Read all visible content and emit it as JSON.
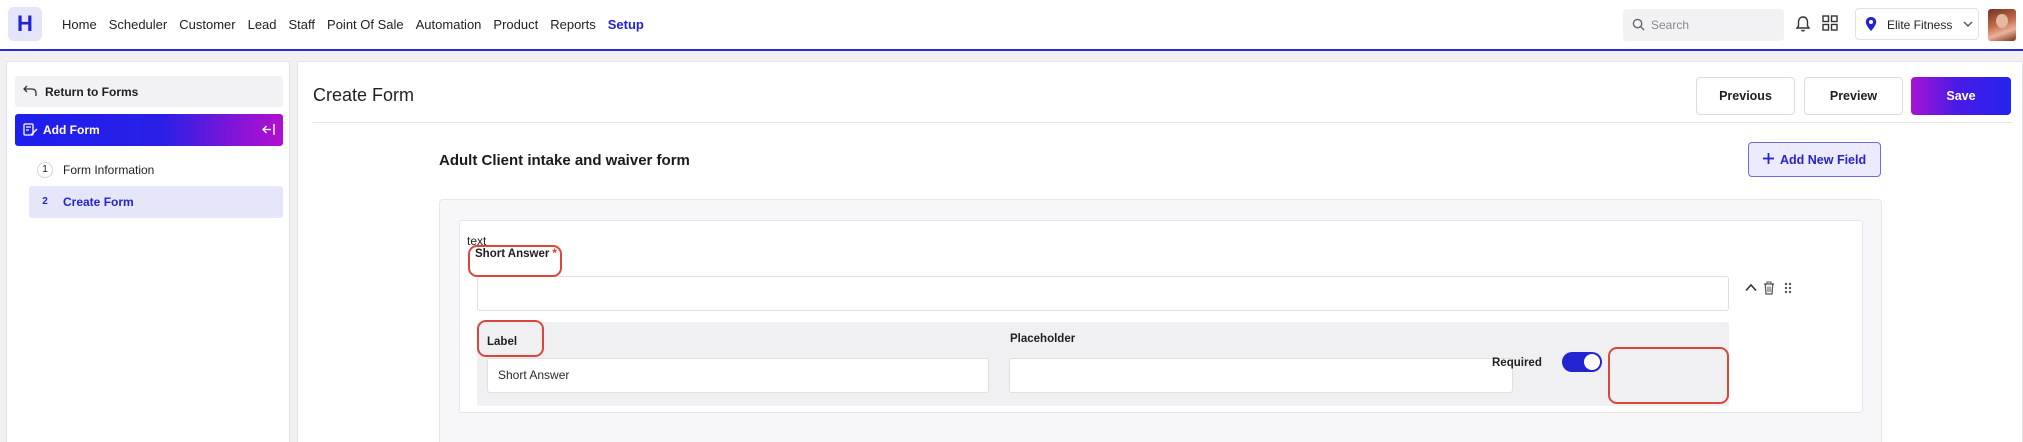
{
  "app": {
    "logo_letter": "H",
    "nav": [
      "Home",
      "Scheduler",
      "Customer",
      "Lead",
      "Staff",
      "Point Of Sale",
      "Automation",
      "Product",
      "Reports",
      "Setup"
    ],
    "active_nav": "Setup",
    "search_placeholder": "Search",
    "location": "Elite Fitness"
  },
  "sidebar": {
    "return_label": "Return to Forms",
    "section_label": "Add Form",
    "steps": [
      {
        "number": "1",
        "label": "Form Information"
      },
      {
        "number": "2",
        "label": "Create Form"
      }
    ],
    "active_step": 2
  },
  "main": {
    "title": "Create Form",
    "buttons": {
      "previous": "Previous",
      "preview": "Preview",
      "save": "Save"
    },
    "form_title": "Adult Client intake and waiver form",
    "add_field_label": "Add New Field",
    "field": {
      "type": "text",
      "name": "Short Answer",
      "required_marker": "*",
      "settings": {
        "label_heading": "Label",
        "label_value": "Short Answer",
        "placeholder_heading": "Placeholder",
        "placeholder_value": "",
        "required_heading": "Required",
        "required_on": true
      }
    }
  },
  "colors": {
    "accent": "#2323cf",
    "highlight": "#d9473a",
    "gradient_start": "#1e1eef",
    "gradient_end": "#b20fd0"
  },
  "icons": [
    "search-icon",
    "bell-icon",
    "apps-grid-icon",
    "location-pin-icon",
    "chevron-down-icon",
    "return-arrow-icon",
    "form-edit-icon",
    "collapse-sidebar-icon",
    "plus-icon",
    "chevron-up-icon",
    "trash-icon",
    "drag-handle-icon"
  ]
}
